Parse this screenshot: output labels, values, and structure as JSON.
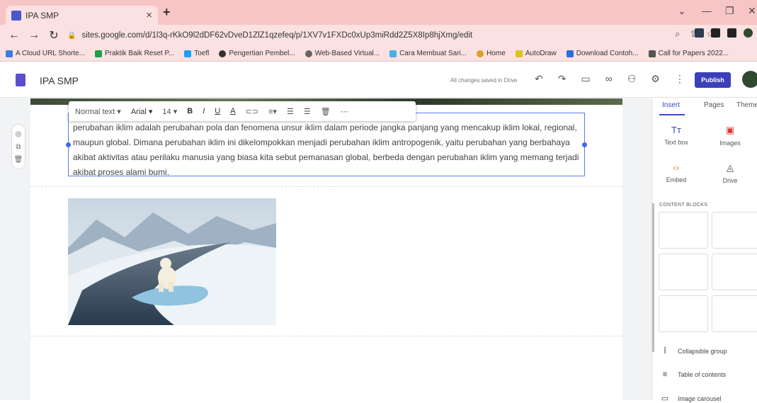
{
  "browser": {
    "tab_title": "IPA SMP",
    "tab_close": "×",
    "new_tab": "+",
    "url": "sites.google.com/d/1l3q-rKkO9l2dDF62vDveD1ZlZ1qzefeq/p/1XV7v1FXDc0xUp3miRdd2Z5X8Ip8hjXmg/edit",
    "bookmarks": [
      {
        "label": "A Cloud URL Shorte...",
        "color": "#3b7be0"
      },
      {
        "label": "Praktik Baik Reset P...",
        "color": "#1e9e4a"
      },
      {
        "label": "Toefl",
        "color": "#1da1f2"
      },
      {
        "label": "Pengertian Pembel...",
        "color": "#333333"
      },
      {
        "label": "Web-Based Virtual...",
        "color": "#666666"
      },
      {
        "label": "Cara Membuat Sari...",
        "color": "#4ab0e0"
      },
      {
        "label": "Home",
        "color": "#e0a21e"
      },
      {
        "label": "AutoDraw",
        "color": "#e0c21e"
      },
      {
        "label": "Download Contoh...",
        "color": "#2a6fd8"
      },
      {
        "label": "Call for Papers 2022...",
        "color": "#555555"
      }
    ]
  },
  "app": {
    "site_title": "IPA SMP",
    "saved_status": "All changes saved in Drive",
    "publish_label": "Publish"
  },
  "format_bar": {
    "style": "Normal text",
    "font": "Arial",
    "size": "14"
  },
  "content": {
    "paragraph": "perubahan iklim adalah perubahan pola dan fenomena unsur iklim dalam periode jangka panjang yang mencakup iklim lokal, regional, maupun global. Dimana perubahan iklim ini dikelompokkan menjadi perubahan iklim antropogenik, yaitu perubahan yang berbahaya akibat aktivitas atau perilaku manusia yang biasa kita sebut pemanasan global, berbeda dengan perubahan iklim yang memang terjadi akibat proses alami bumi."
  },
  "sidebar": {
    "tabs": [
      "Insert",
      "Pages",
      "Themes"
    ],
    "insert_items": [
      {
        "label": "Text box",
        "icon": "text-box-icon"
      },
      {
        "label": "Images",
        "icon": "image-icon"
      },
      {
        "label": "Embed",
        "icon": "embed-icon"
      },
      {
        "label": "Drive",
        "icon": "drive-icon"
      }
    ],
    "content_blocks_title": "CONTENT BLOCKS",
    "list_items": [
      {
        "label": "Collapsible group",
        "icon": "collapsible-icon"
      },
      {
        "label": "Table of contents",
        "icon": "toc-icon"
      },
      {
        "label": "Image carousel",
        "icon": "carousel-icon"
      }
    ]
  }
}
